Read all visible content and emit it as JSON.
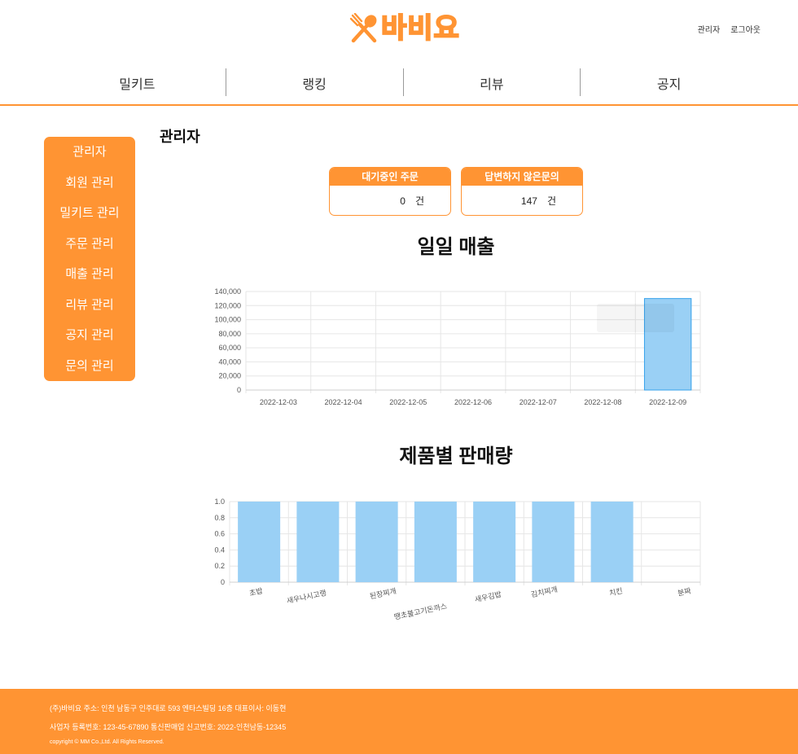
{
  "header": {
    "logo_text": "바비요",
    "links": [
      "관리자",
      "로그아웃"
    ]
  },
  "nav": {
    "items": [
      "밀키트",
      "랭킹",
      "리뷰",
      "공지"
    ]
  },
  "sidebar": {
    "items": [
      "관리자",
      "회원 관리",
      "밀키트 관리",
      "주문 관리",
      "매출 관리",
      "리뷰 관리",
      "공지 관리",
      "문의 관리"
    ]
  },
  "main": {
    "title": "관리자",
    "cards": [
      {
        "label": "대기중인 주문",
        "value": "0",
        "unit": "건"
      },
      {
        "label": "답변하지 않은문의",
        "value": "147",
        "unit": "건"
      }
    ],
    "daily_sales_title": "일일 매출",
    "product_sales_title": "제품별 판매량"
  },
  "colors": {
    "accent": "#ff9433",
    "bar_fill": "#9ad0f5",
    "bar_stroke": "#36a2eb"
  },
  "chart_data": [
    {
      "type": "bar",
      "title": "일일 매출",
      "categories": [
        "2022-12-03",
        "2022-12-04",
        "2022-12-05",
        "2022-12-06",
        "2022-12-07",
        "2022-12-08",
        "2022-12-09"
      ],
      "values": [
        0,
        0,
        0,
        0,
        0,
        0,
        130000
      ],
      "ylim": [
        0,
        140000
      ],
      "yticks": [
        "140,000",
        "120,000",
        "100,000",
        "80,000",
        "60,000",
        "40,000",
        "20,000",
        "0"
      ],
      "grid": true
    },
    {
      "type": "bar",
      "title": "제품별 판매량",
      "categories": [
        "초밥",
        "새우나시고랭",
        "된장찌개",
        "땡초불고기돈까스",
        "새우김밥",
        "김치찌개",
        "치킨",
        "분짜"
      ],
      "values": [
        1,
        1,
        1,
        1,
        1,
        1,
        1
      ],
      "ylim": [
        0,
        1.0
      ],
      "yticks": [
        "1.0",
        "0.8",
        "0.6",
        "0.4",
        "0.2",
        "0"
      ],
      "grid": true
    }
  ],
  "footer": {
    "line1": "(주)바비요  주소: 인천 남동구 인주대로 593 엔타스빌딩 16층  대표이사: 이동현",
    "line2": "사업자 등록번호: 123-45-67890  통신판매업 신고번호: 2022-인천남동-12345",
    "line3": "copyright © MM Co.,Ltd. All Rights Reserved."
  }
}
